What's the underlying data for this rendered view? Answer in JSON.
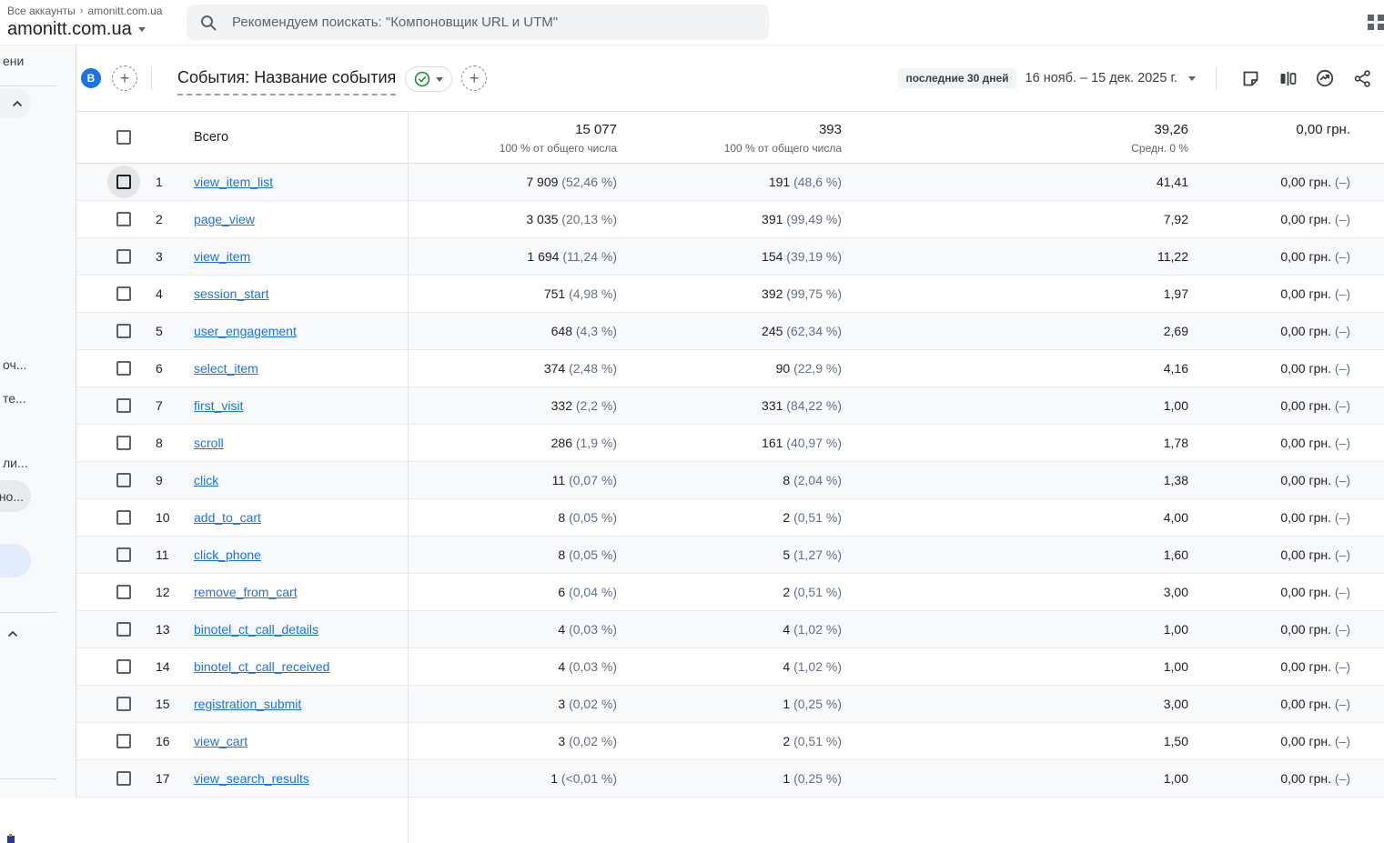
{
  "app": {
    "breadcrumb": {
      "root": "Все аккаунты",
      "separator": "›",
      "account": "amonitt.com.ua"
    },
    "account_selector": "amonitt.com.ua",
    "search": {
      "placeholder": "Рекомендуем поискать: \"Компоновщик URL и UTM\""
    }
  },
  "sidebar": {
    "items": [
      {
        "label": "ени"
      },
      {
        "label": "оч..."
      },
      {
        "label": "те..."
      },
      {
        "label": "ли..."
      },
      {
        "label": "но..."
      }
    ]
  },
  "report": {
    "avatar_letter": "B",
    "title": "События: Название события",
    "plus_label": "+",
    "date_preset": "последние 30 дней",
    "date_range": "16 нояб. – 15 дек. 2025 г."
  },
  "table": {
    "total_label": "Всего",
    "totals": {
      "events": {
        "value": "15 077",
        "caption": "100 % от общего числа"
      },
      "users": {
        "value": "393",
        "caption": "100 % от общего числа"
      },
      "avg": {
        "value": "39,26",
        "caption": "Средн. 0 %"
      },
      "revenue": {
        "value": "0,00 грн."
      }
    },
    "rows": [
      {
        "n": "1",
        "name": "view_item_list",
        "events": "7 909",
        "events_pct": "(52,46 %)",
        "users": "191",
        "users_pct": "(48,6 %)",
        "per_user": "41,41",
        "revenue": "0,00 грн.",
        "revenue_note": "(–)"
      },
      {
        "n": "2",
        "name": "page_view",
        "events": "3 035",
        "events_pct": "(20,13 %)",
        "users": "391",
        "users_pct": "(99,49 %)",
        "per_user": "7,92",
        "revenue": "0,00 грн.",
        "revenue_note": "(–)"
      },
      {
        "n": "3",
        "name": "view_item",
        "events": "1 694",
        "events_pct": "(11,24 %)",
        "users": "154",
        "users_pct": "(39,19 %)",
        "per_user": "11,22",
        "revenue": "0,00 грн.",
        "revenue_note": "(–)"
      },
      {
        "n": "4",
        "name": "session_start",
        "events": "751",
        "events_pct": "(4,98 %)",
        "users": "392",
        "users_pct": "(99,75 %)",
        "per_user": "1,97",
        "revenue": "0,00 грн.",
        "revenue_note": "(–)"
      },
      {
        "n": "5",
        "name": "user_engagement",
        "events": "648",
        "events_pct": "(4,3 %)",
        "users": "245",
        "users_pct": "(62,34 %)",
        "per_user": "2,69",
        "revenue": "0,00 грн.",
        "revenue_note": "(–)"
      },
      {
        "n": "6",
        "name": "select_item",
        "events": "374",
        "events_pct": "(2,48 %)",
        "users": "90",
        "users_pct": "(22,9 %)",
        "per_user": "4,16",
        "revenue": "0,00 грн.",
        "revenue_note": "(–)"
      },
      {
        "n": "7",
        "name": "first_visit",
        "events": "332",
        "events_pct": "(2,2 %)",
        "users": "331",
        "users_pct": "(84,22 %)",
        "per_user": "1,00",
        "revenue": "0,00 грн.",
        "revenue_note": "(–)"
      },
      {
        "n": "8",
        "name": "scroll",
        "events": "286",
        "events_pct": "(1,9 %)",
        "users": "161",
        "users_pct": "(40,97 %)",
        "per_user": "1,78",
        "revenue": "0,00 грн.",
        "revenue_note": "(–)"
      },
      {
        "n": "9",
        "name": "click",
        "events": "11",
        "events_pct": "(0,07 %)",
        "users": "8",
        "users_pct": "(2,04 %)",
        "per_user": "1,38",
        "revenue": "0,00 грн.",
        "revenue_note": "(–)"
      },
      {
        "n": "10",
        "name": "add_to_cart",
        "events": "8",
        "events_pct": "(0,05 %)",
        "users": "2",
        "users_pct": "(0,51 %)",
        "per_user": "4,00",
        "revenue": "0,00 грн.",
        "revenue_note": "(–)"
      },
      {
        "n": "11",
        "name": "click_phone",
        "events": "8",
        "events_pct": "(0,05 %)",
        "users": "5",
        "users_pct": "(1,27 %)",
        "per_user": "1,60",
        "revenue": "0,00 грн.",
        "revenue_note": "(–)"
      },
      {
        "n": "12",
        "name": "remove_from_cart",
        "events": "6",
        "events_pct": "(0,04 %)",
        "users": "2",
        "users_pct": "(0,51 %)",
        "per_user": "3,00",
        "revenue": "0,00 грн.",
        "revenue_note": "(–)"
      },
      {
        "n": "13",
        "name": "binotel_ct_call_details",
        "events": "4",
        "events_pct": "(0,03 %)",
        "users": "4",
        "users_pct": "(1,02 %)",
        "per_user": "1,00",
        "revenue": "0,00 грн.",
        "revenue_note": "(–)"
      },
      {
        "n": "14",
        "name": "binotel_ct_call_received",
        "events": "4",
        "events_pct": "(0,03 %)",
        "users": "4",
        "users_pct": "(1,02 %)",
        "per_user": "1,00",
        "revenue": "0,00 грн.",
        "revenue_note": "(–)"
      },
      {
        "n": "15",
        "name": "registration_submit",
        "events": "3",
        "events_pct": "(0,02 %)",
        "users": "1",
        "users_pct": "(0,25 %)",
        "per_user": "3,00",
        "revenue": "0,00 грн.",
        "revenue_note": "(–)"
      },
      {
        "n": "16",
        "name": "view_cart",
        "events": "3",
        "events_pct": "(0,02 %)",
        "users": "2",
        "users_pct": "(0,51 %)",
        "per_user": "1,50",
        "revenue": "0,00 грн.",
        "revenue_note": "(–)"
      },
      {
        "n": "17",
        "name": "view_search_results",
        "events": "1",
        "events_pct": "(<0,01 %)",
        "users": "1",
        "users_pct": "(0,25 %)",
        "per_user": "1,00",
        "revenue": "0,00 грн.",
        "revenue_note": "(–)"
      }
    ]
  },
  "icons": [
    "search-icon",
    "apps-grid-icon",
    "chevron-down-icon",
    "plus-icon",
    "checkmark-circle-icon",
    "notes-icon",
    "comparison-icon",
    "insights-icon",
    "share-icon",
    "checkbox-icon",
    "collapse-up-icon",
    "breadcrumb-chevron-icon"
  ],
  "colors": {
    "accent_blue": "#1a73e8",
    "link_blue": "#1a73e8",
    "secondary_text": "#5f6368",
    "percent_text": "#646e8c",
    "green_check": "#1e8e3e",
    "zebra_row": "#f8f9fa",
    "sidebar_bg": "#f8f9fa",
    "chip_bg": "#f1f3f4"
  }
}
